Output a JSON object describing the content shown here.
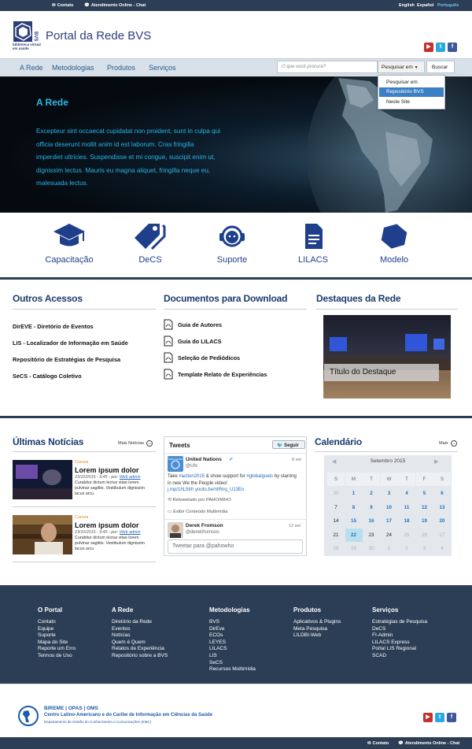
{
  "topbar": {
    "contact": "Contato",
    "chat": "Atendimento Online - Chat",
    "languages": [
      "English",
      "Español",
      "Português"
    ]
  },
  "header": {
    "logo_text": "biblioteca virtual em saúde",
    "title": "Portal da Rede BVS"
  },
  "nav": {
    "items": [
      "A Rede",
      "Metodologias",
      "Produtos",
      "Serviços"
    ],
    "search_placeholder": "O que você procura?",
    "search_scope_label": "Pesquisar em",
    "search_button": "Buscar",
    "scope_options": [
      "Pesquisar em",
      "Repositório BVS",
      "Neste Site"
    ],
    "scope_selected": "Repositório BVS"
  },
  "hero": {
    "title": "A Rede",
    "text": "Excepteur sint occaecat cupidatat non proident, sunt in culpa qui officia deserunt mollit anim id est laborum. Cras fringilla imperdiet ultricies. Suspendisse et mi congue, suscipit enim ut, dignissim lectus. Mauris eu magna aliquet, fringilla neque eu, malesuada lectus."
  },
  "features": [
    "Capacitação",
    "DeCS",
    "Suporte",
    "LILACS",
    "Modelo"
  ],
  "outros_acessos": {
    "heading": "Outros Acessos",
    "links": [
      "DirEVE - Diretório de Eventos",
      "LIS - Localizador de Informação em Saúde",
      "Repositório de Estratégias de Pesquisa",
      "SeCS - Catálogo Coletivo"
    ]
  },
  "documentos": {
    "heading": "Documentos para Download",
    "items": [
      "Guia de Autores",
      "Guia do LILACS",
      "Seleção de Pediódicos",
      "Template Relato de Experiências"
    ]
  },
  "destaques": {
    "heading": "Destaques da Rede",
    "caption": "Título do Destaque"
  },
  "noticias": {
    "heading": "Últimas Notícias",
    "more": "Mais Notícias",
    "items": [
      {
        "category": "Cursos",
        "title": "Lorem ipsum dolor",
        "meta": "23/10/2015 - 9:45 - por:",
        "author": "Web admin",
        "body": "Curabitur dictum lectus vitae lorem pulvinar sagittis. Vestibulum dignissim lacus arcu"
      },
      {
        "category": "Cursos",
        "title": "Lorem ipsum dolor",
        "meta": "23/10/2015 - 9:45 - por:",
        "author": "Web admin",
        "body": "Curabitur dictum lectus vitae lorem pulvinar sagittis. Vestibulum dignissim lacus arcu"
      }
    ]
  },
  "tweets": {
    "heading": "Tweets",
    "follow": "Seguir",
    "items": [
      {
        "name": "United Nations",
        "handle": "@UN",
        "time": "8 set",
        "text_pre": "Take ",
        "hashtag1": "#action2015",
        "text_mid": " & show support for ",
        "hashtag2": "#globalgoals",
        "text_post": " by starring in new We the People video!",
        "link": "j.mp/1hL5trh youtu.be/ntRnq_U13Eo",
        "retweet": "Retweetado por PAHO/WHO",
        "media": "Exibir Conteúdo Multimídia"
      },
      {
        "name": "Derek Fromson",
        "handle": "@derekfromson",
        "time": "12 set"
      }
    ],
    "input_placeholder": "Tweetar para @pahowho"
  },
  "calendar": {
    "heading": "Calendário",
    "more": "Mais",
    "month": "Setembro 2015",
    "weekdays": [
      "S",
      "M",
      "T",
      "W",
      "T",
      "F",
      "S"
    ],
    "rows": [
      [
        "30",
        "1",
        "2",
        "3",
        "4",
        "5",
        "6"
      ],
      [
        "7",
        "8",
        "9",
        "10",
        "11",
        "12",
        "13"
      ],
      [
        "14",
        "15",
        "16",
        "17",
        "18",
        "19",
        "20"
      ],
      [
        "21",
        "22",
        "23",
        "24",
        "25",
        "26",
        "27"
      ],
      [
        "28",
        "29",
        "30",
        "1",
        "2",
        "3",
        "4"
      ]
    ]
  },
  "footer": {
    "columns": [
      {
        "title": "O Portal",
        "links": [
          "Contato",
          "Equipe",
          "Suporte",
          "Mapa do Site",
          "Reporte um Erro",
          "Termos de Uso"
        ]
      },
      {
        "title": "A Rede",
        "links": [
          "Diretório da Rede",
          "Eventos",
          "Notícias",
          "Quem é Quem",
          "Relatos de Experiência",
          "Repositório sobre a BVS"
        ]
      },
      {
        "title": "Metodologias",
        "links": [
          "BVS",
          "DirEve",
          "ECOs",
          "LEYES",
          "LILACS",
          "LIS",
          "SeCS",
          "Recursos Multimídia"
        ]
      },
      {
        "title": "Produtos",
        "links": [
          "Aplicativos & Plugins",
          "Meta Pesquisa",
          "LILDBI-Web"
        ]
      },
      {
        "title": "Serviços",
        "links": [
          "Estratégias de Pesquisa",
          "DeCS",
          "FI-Admin",
          "LILACS Express",
          "Portal LIS Regional",
          "SCAD"
        ]
      }
    ]
  },
  "bireme": {
    "line1": "BIREME | OPAS | OMS",
    "line2": "Centro Latino-Americano e do Caribe de Informação em Ciências da Saúde",
    "line3": "Departamento de Gestão do Conhecimento e Comunicações (KMC)"
  },
  "colors": {
    "dark": "#2c3e55",
    "accent": "#2eb8e6",
    "heading": "#1e3a6e",
    "link": "#1b6fc9"
  }
}
